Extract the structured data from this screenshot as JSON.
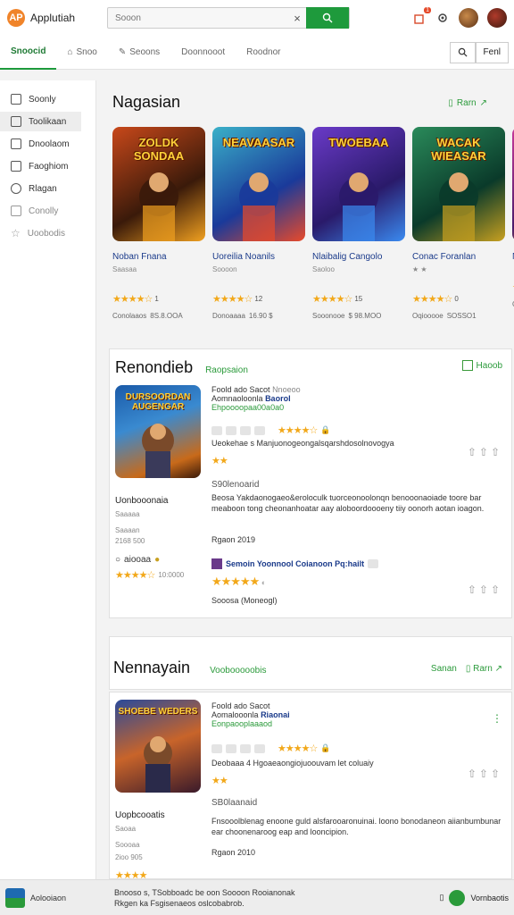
{
  "header": {
    "logo_glyph": "AP",
    "app_name": "Applutiah",
    "search_placeholder": "Sooon",
    "clear_glyph": "×",
    "notification_count": "1"
  },
  "tabs": [
    {
      "label": "Snoocid",
      "active": true
    },
    {
      "label": "Snoo"
    },
    {
      "label": "Seoons"
    },
    {
      "label": "Doonnooot"
    },
    {
      "label": "Roodnor"
    }
  ],
  "tab_right_label": "Fenl",
  "sidebar": [
    {
      "label": "Soonly",
      "icon": "home-icon"
    },
    {
      "label": "Toolikaan",
      "icon": "list-icon",
      "active": true
    },
    {
      "label": "Dnoolaom",
      "icon": "house-icon"
    },
    {
      "label": "Faoghiom",
      "icon": "doc-icon"
    },
    {
      "label": "Rlagan",
      "icon": "user-icon"
    },
    {
      "label": "Conolly",
      "icon": "edit-icon",
      "dim": true
    },
    {
      "label": "Uoobodis",
      "icon": "star-icon",
      "dim": true
    }
  ],
  "featured": {
    "title": "Nagasian",
    "more": "Rarn",
    "cards": [
      {
        "art_text": "ZOLDK SONDAA",
        "name": "Noban Fnana",
        "sub": "Saasaa",
        "rating_count": "1",
        "meta1": "Conolaaos",
        "meta2": "8S.8.OOA",
        "stars": 4,
        "colors": [
          "#3a1a0a",
          "#c8481a",
          "#f0a020"
        ]
      },
      {
        "art_text": "NEAVAASAR",
        "name": "Uoreilia Noanils",
        "sub": "Soooon",
        "rating_count": "12",
        "meta1": "Donoaaaa",
        "meta2": "16.90 $",
        "stars": 4,
        "colors": [
          "#1a3a9a",
          "#3ab0c8",
          "#e84a2a"
        ]
      },
      {
        "art_text": "TWOEBAA",
        "name": "Nlaibalig Cangolo",
        "sub": "Saoloo",
        "rating_count": "15",
        "meta1": "Sooonooe",
        "meta2": "$ 98.MOO",
        "stars": 4,
        "colors": [
          "#2a1a6a",
          "#6a3ac8",
          "#3a8af0"
        ]
      },
      {
        "art_text": "WACAK WIEASAR",
        "name": "Conac Foranlan",
        "sub": "★ ★",
        "rating_count": "0",
        "meta1": "Oqiooooe",
        "meta2": "SOSSO1",
        "stars": 4,
        "colors": [
          "#0a3a2a",
          "#2a8a5a",
          "#c8a020"
        ]
      },
      {
        "art_text": "NA",
        "name": "Nar",
        "sub": "",
        "rating_count": "",
        "meta1": "Coo",
        "meta2": "",
        "stars": 4,
        "colors": [
          "#4a1a6a",
          "#c83a9a",
          "#f0a020"
        ]
      }
    ]
  },
  "recommended": {
    "title": "Renondieb",
    "tag": "Raopsaion",
    "toggle": "Haoob",
    "art_text": "DURSOORDAN AUGENGAR",
    "game_title": "Uonbooonaia",
    "small1": "Saaaaa",
    "small2": "Saaaan",
    "small3": "2168 500",
    "favorite": "aiooaa",
    "rating_count": "10:0000",
    "line1": "Foold ado Sacot",
    "line1_extra": "Nnoeoo",
    "line2": "Aomnaoloonla",
    "line2_link": "Baorol",
    "line3": "Ehpoooopaa00a0a0",
    "line4": "Ueokehae s Manjuonogeongalsqarshdosolnovogya",
    "section2": "S90lenoarid",
    "para": "Beosa Yakdaonogaeo&eroloculk tuorceonoolonqn benooonaoiade toore bar meaboon tong cheonanhoatar aay aloboordoooeny tiiy oonorh aotan ioagon.",
    "date": "Rgaon 2019",
    "review_author": "Semoin Yoonnool Coianoon Pq:hailt",
    "review_status": "Sooosa (Moneogl)"
  },
  "newest": {
    "title": "Nennayain",
    "tag": "Voobooooobis",
    "action1": "Sanan",
    "action2": "Rarn",
    "art_text": "SHOEBE WEDERS",
    "game_title": "Uopbcooatis",
    "small1": "Saoaa",
    "small2": "Soooaa",
    "small3": "2ioo 905",
    "line1": "Foold ado Sacot",
    "line2": "Aomalooonla",
    "line2_link": "Riaonai",
    "line3": "Eonpaooplaaaod",
    "line4": "Deobaaa 4 Hgoaeaongiojuoouvam let coluaiy",
    "section2": "SB0laanaid",
    "para": "Fnsooolblenag enoone guld alsfarooaronuinai. loono bonodaneon aiianbumbunar ear choonenaroog eap and looncipion.",
    "date": "Rgaon 2010"
  },
  "footer": {
    "label": "Aolooiaon",
    "mid_line1": "Bnooso s, TSobboadc be oon Soooon Rooianonak",
    "mid_line2": "Rkgen ka Fsgisenaeos oslcobabrob.",
    "right": "Vornbaotis"
  }
}
